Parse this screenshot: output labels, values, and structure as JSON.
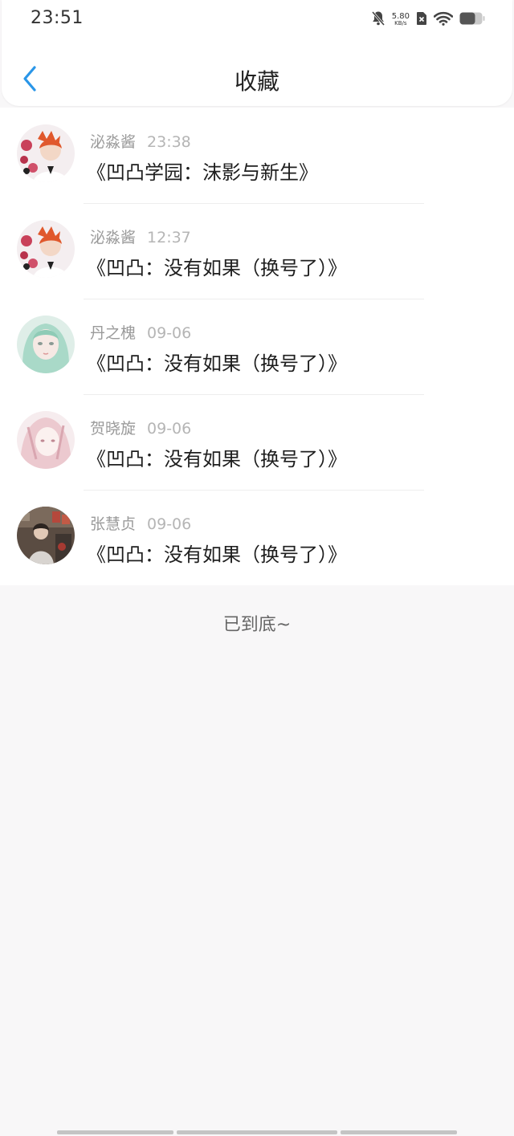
{
  "status_bar": {
    "time": "23:51",
    "net_speed_value": "5.80",
    "net_speed_unit": "KB/s",
    "icons": [
      "bell-muted-icon",
      "sim-none-icon",
      "wifi-icon",
      "battery-icon"
    ]
  },
  "header": {
    "title": "收藏",
    "back_icon": "chevron-left-icon",
    "accent_color": "#2a96e8"
  },
  "favorites": [
    {
      "user": "泌淼酱",
      "time": "23:38",
      "title": "《凹凸学园：沫影与新生》"
    },
    {
      "user": "泌淼酱",
      "time": "12:37",
      "title": "《凹凸：没有如果（换号了）》"
    },
    {
      "user": "丹之槐",
      "time": "09-06",
      "title": "《凹凸：没有如果（换号了）》"
    },
    {
      "user": "贺晓旋",
      "time": "09-06",
      "title": "《凹凸：没有如果（换号了）》"
    },
    {
      "user": "张慧贞",
      "time": "09-06",
      "title": "《凹凸：没有如果（换号了）》"
    }
  ],
  "footer": {
    "end_text": "已到底~"
  }
}
